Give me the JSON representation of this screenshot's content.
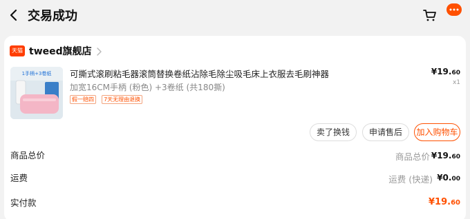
{
  "header": {
    "title": "交易成功"
  },
  "store": {
    "logo_text": "天猫",
    "name": "tweed旗舰店"
  },
  "product": {
    "image_label": "1手柄+3卷纸",
    "title": "可撕式滚刷粘毛器滚筒替换卷纸沾除毛除尘吸毛床上衣服去毛刷神器",
    "sku": "加宽16CM手柄 (粉色) +3卷纸 (共180撕)",
    "tags": [
      "假一赔四",
      "7天无理由退换"
    ],
    "price_symbol": "¥",
    "price_int": "19.",
    "price_dec": "60",
    "quantity": "x1"
  },
  "actions": {
    "exchange": "卖了换钱",
    "aftersale": "申请售后",
    "add_cart": "加入购物车"
  },
  "summary": {
    "goods_total_label": "商品总价",
    "goods_total_sub": "商品总价",
    "goods_total_int": "¥19.",
    "goods_total_dec": "60",
    "shipping_label": "运费",
    "shipping_sub": "运费 (快递)",
    "shipping_int": "¥0.",
    "shipping_dec": "00",
    "paid_label": "实付款",
    "paid_int": "¥19.",
    "paid_dec": "60"
  },
  "colors": {
    "accent": "#ff5000",
    "background": "#f2f2f2"
  }
}
